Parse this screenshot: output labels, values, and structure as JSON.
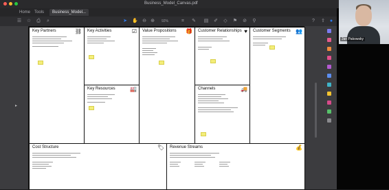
{
  "window": {
    "title": "Business_Model_Canvas.pdf"
  },
  "tabs": [
    {
      "label": "Home"
    },
    {
      "label": "Tools"
    },
    {
      "label": "Business_Model..."
    }
  ],
  "toolbar": {
    "zoom": "92%"
  },
  "canvas": {
    "key_partners": "Key Partners",
    "key_activities": "Key Activities",
    "key_resources": "Key Resources",
    "value_propositions": "Value Propositions",
    "customer_relationships": "Customer Relationships",
    "channels": "Channels",
    "customer_segments": "Customer Segments",
    "cost_structure": "Cost Structure",
    "revenue_streams": "Revenue Streams"
  },
  "video": {
    "participant_name": "Jan Pakowsky"
  },
  "colors": {
    "sticky": "#f4ee7a",
    "accent": "#2d7bf0"
  }
}
